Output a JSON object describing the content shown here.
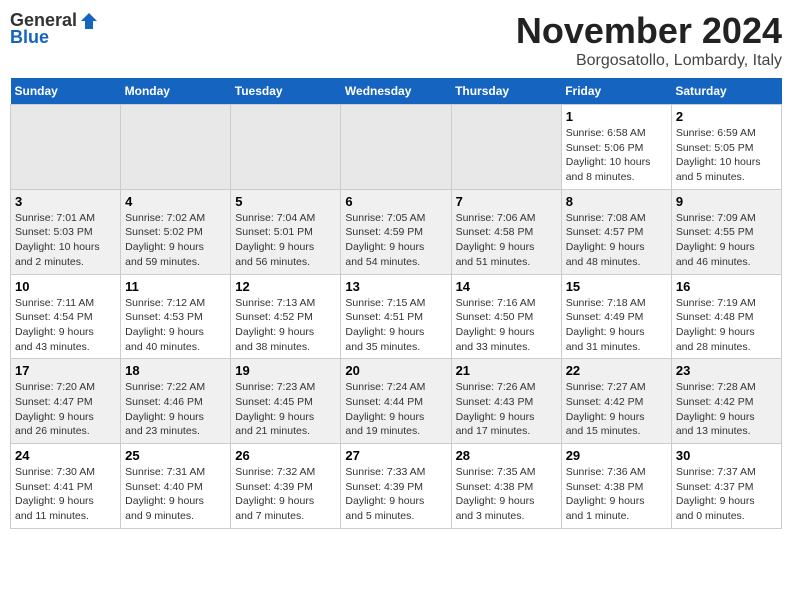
{
  "header": {
    "logo_general": "General",
    "logo_blue": "Blue",
    "month_title": "November 2024",
    "location": "Borgosatollo, Lombardy, Italy"
  },
  "days_of_week": [
    "Sunday",
    "Monday",
    "Tuesday",
    "Wednesday",
    "Thursday",
    "Friday",
    "Saturday"
  ],
  "weeks": [
    [
      {
        "day": "",
        "info": ""
      },
      {
        "day": "",
        "info": ""
      },
      {
        "day": "",
        "info": ""
      },
      {
        "day": "",
        "info": ""
      },
      {
        "day": "",
        "info": ""
      },
      {
        "day": "1",
        "info": "Sunrise: 6:58 AM\nSunset: 5:06 PM\nDaylight: 10 hours\nand 8 minutes."
      },
      {
        "day": "2",
        "info": "Sunrise: 6:59 AM\nSunset: 5:05 PM\nDaylight: 10 hours\nand 5 minutes."
      }
    ],
    [
      {
        "day": "3",
        "info": "Sunrise: 7:01 AM\nSunset: 5:03 PM\nDaylight: 10 hours\nand 2 minutes."
      },
      {
        "day": "4",
        "info": "Sunrise: 7:02 AM\nSunset: 5:02 PM\nDaylight: 9 hours\nand 59 minutes."
      },
      {
        "day": "5",
        "info": "Sunrise: 7:04 AM\nSunset: 5:01 PM\nDaylight: 9 hours\nand 56 minutes."
      },
      {
        "day": "6",
        "info": "Sunrise: 7:05 AM\nSunset: 4:59 PM\nDaylight: 9 hours\nand 54 minutes."
      },
      {
        "day": "7",
        "info": "Sunrise: 7:06 AM\nSunset: 4:58 PM\nDaylight: 9 hours\nand 51 minutes."
      },
      {
        "day": "8",
        "info": "Sunrise: 7:08 AM\nSunset: 4:57 PM\nDaylight: 9 hours\nand 48 minutes."
      },
      {
        "day": "9",
        "info": "Sunrise: 7:09 AM\nSunset: 4:55 PM\nDaylight: 9 hours\nand 46 minutes."
      }
    ],
    [
      {
        "day": "10",
        "info": "Sunrise: 7:11 AM\nSunset: 4:54 PM\nDaylight: 9 hours\nand 43 minutes."
      },
      {
        "day": "11",
        "info": "Sunrise: 7:12 AM\nSunset: 4:53 PM\nDaylight: 9 hours\nand 40 minutes."
      },
      {
        "day": "12",
        "info": "Sunrise: 7:13 AM\nSunset: 4:52 PM\nDaylight: 9 hours\nand 38 minutes."
      },
      {
        "day": "13",
        "info": "Sunrise: 7:15 AM\nSunset: 4:51 PM\nDaylight: 9 hours\nand 35 minutes."
      },
      {
        "day": "14",
        "info": "Sunrise: 7:16 AM\nSunset: 4:50 PM\nDaylight: 9 hours\nand 33 minutes."
      },
      {
        "day": "15",
        "info": "Sunrise: 7:18 AM\nSunset: 4:49 PM\nDaylight: 9 hours\nand 31 minutes."
      },
      {
        "day": "16",
        "info": "Sunrise: 7:19 AM\nSunset: 4:48 PM\nDaylight: 9 hours\nand 28 minutes."
      }
    ],
    [
      {
        "day": "17",
        "info": "Sunrise: 7:20 AM\nSunset: 4:47 PM\nDaylight: 9 hours\nand 26 minutes."
      },
      {
        "day": "18",
        "info": "Sunrise: 7:22 AM\nSunset: 4:46 PM\nDaylight: 9 hours\nand 23 minutes."
      },
      {
        "day": "19",
        "info": "Sunrise: 7:23 AM\nSunset: 4:45 PM\nDaylight: 9 hours\nand 21 minutes."
      },
      {
        "day": "20",
        "info": "Sunrise: 7:24 AM\nSunset: 4:44 PM\nDaylight: 9 hours\nand 19 minutes."
      },
      {
        "day": "21",
        "info": "Sunrise: 7:26 AM\nSunset: 4:43 PM\nDaylight: 9 hours\nand 17 minutes."
      },
      {
        "day": "22",
        "info": "Sunrise: 7:27 AM\nSunset: 4:42 PM\nDaylight: 9 hours\nand 15 minutes."
      },
      {
        "day": "23",
        "info": "Sunrise: 7:28 AM\nSunset: 4:42 PM\nDaylight: 9 hours\nand 13 minutes."
      }
    ],
    [
      {
        "day": "24",
        "info": "Sunrise: 7:30 AM\nSunset: 4:41 PM\nDaylight: 9 hours\nand 11 minutes."
      },
      {
        "day": "25",
        "info": "Sunrise: 7:31 AM\nSunset: 4:40 PM\nDaylight: 9 hours\nand 9 minutes."
      },
      {
        "day": "26",
        "info": "Sunrise: 7:32 AM\nSunset: 4:39 PM\nDaylight: 9 hours\nand 7 minutes."
      },
      {
        "day": "27",
        "info": "Sunrise: 7:33 AM\nSunset: 4:39 PM\nDaylight: 9 hours\nand 5 minutes."
      },
      {
        "day": "28",
        "info": "Sunrise: 7:35 AM\nSunset: 4:38 PM\nDaylight: 9 hours\nand 3 minutes."
      },
      {
        "day": "29",
        "info": "Sunrise: 7:36 AM\nSunset: 4:38 PM\nDaylight: 9 hours\nand 1 minute."
      },
      {
        "day": "30",
        "info": "Sunrise: 7:37 AM\nSunset: 4:37 PM\nDaylight: 9 hours\nand 0 minutes."
      }
    ]
  ]
}
